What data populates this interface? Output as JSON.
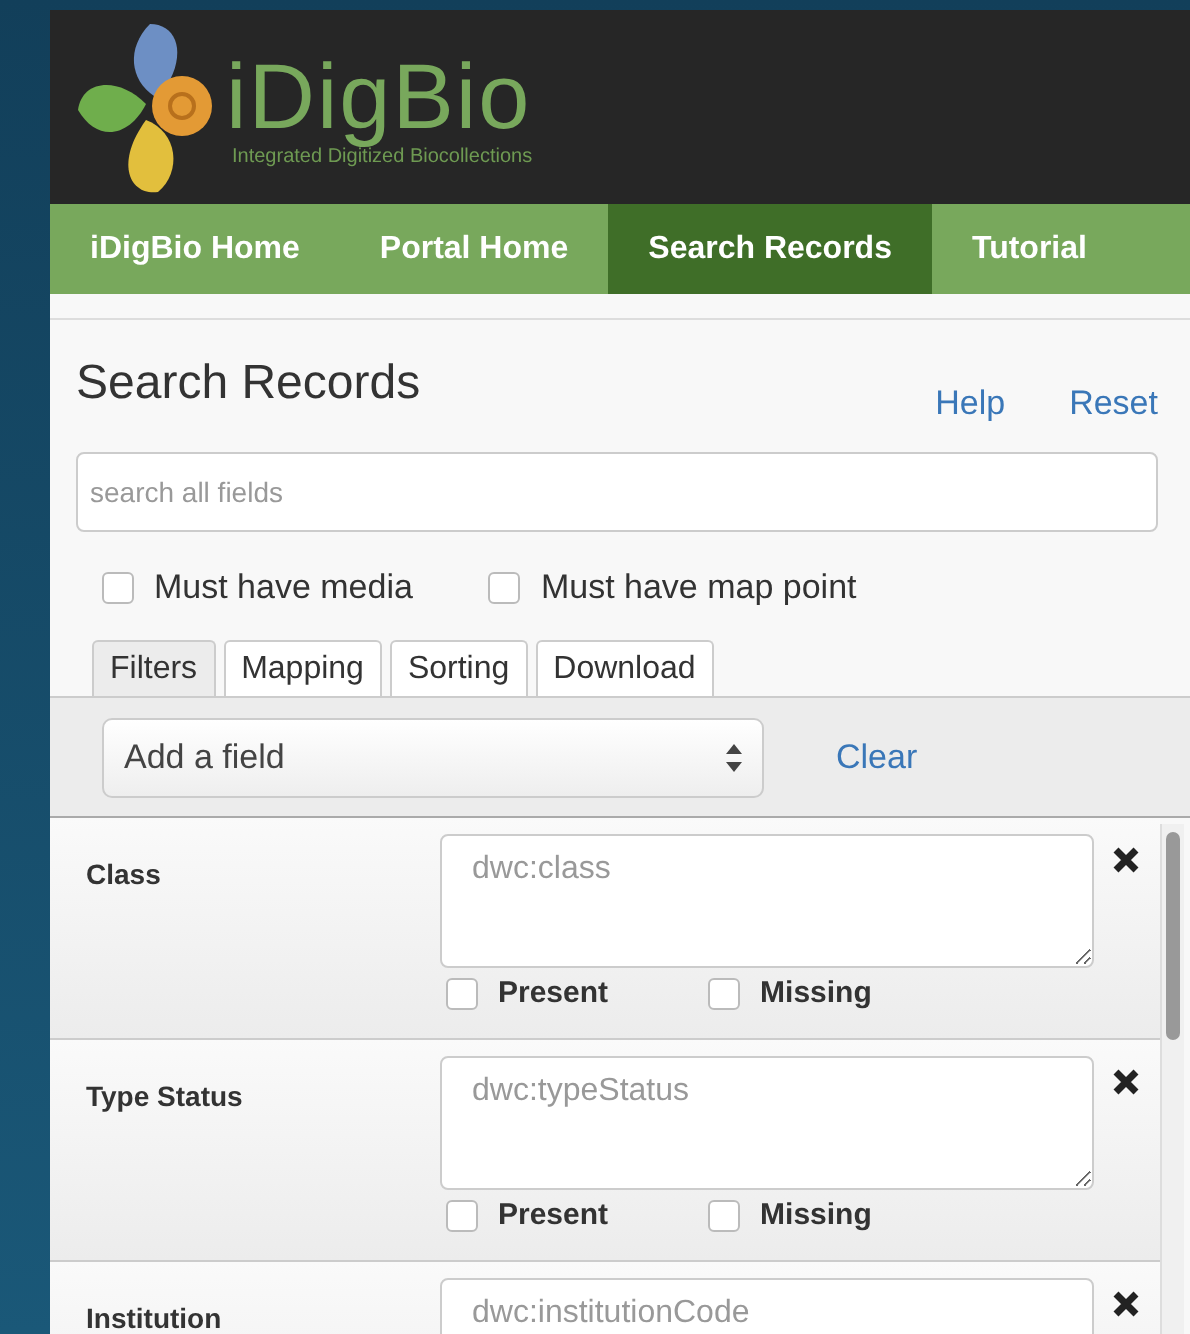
{
  "logo": {
    "name": "iDigBio",
    "tagline": "Integrated Digitized Biocollections"
  },
  "nav": [
    {
      "label": "iDigBio Home",
      "selected": false
    },
    {
      "label": "Portal Home",
      "selected": false
    },
    {
      "label": "Search Records",
      "selected": true
    },
    {
      "label": "Tutorial",
      "selected": false
    }
  ],
  "panel": {
    "title": "Search Records",
    "links": [
      "Help",
      "Reset"
    ],
    "search": {
      "placeholder": "search all fields"
    },
    "options": [
      {
        "label": "Must have media",
        "checked": false
      },
      {
        "label": "Must have map point",
        "checked": false
      }
    ],
    "tabs": [
      {
        "label": "Filters",
        "selected": true
      },
      {
        "label": "Mapping",
        "selected": false
      },
      {
        "label": "Sorting",
        "selected": false
      },
      {
        "label": "Download",
        "selected": false
      }
    ],
    "add_field": {
      "value": "Add a field"
    },
    "clear": "Clear"
  },
  "filters": [
    {
      "label": "Class",
      "placeholder": "dwc:class",
      "checks": [
        {
          "label": "Present",
          "checked": false
        },
        {
          "label": "Missing",
          "checked": false
        }
      ]
    },
    {
      "label": "Type Status",
      "placeholder": "dwc:typeStatus",
      "checks": [
        {
          "label": "Present",
          "checked": false
        },
        {
          "label": "Missing",
          "checked": false
        }
      ]
    },
    {
      "label": "Institution",
      "placeholder": "dwc:institutionCode"
    }
  ]
}
